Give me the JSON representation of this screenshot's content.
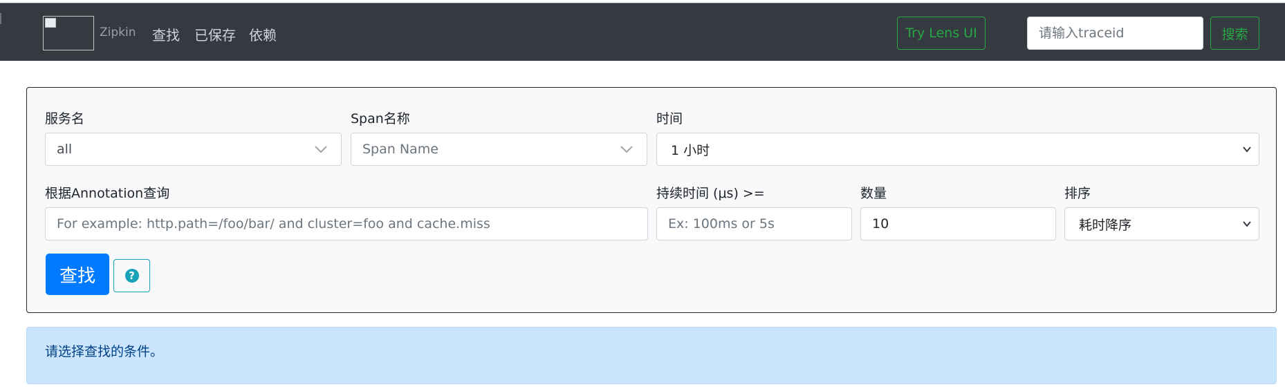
{
  "navbar": {
    "brand": "Zipkin",
    "links": [
      "查找",
      "已保存",
      "依赖"
    ],
    "lens_button": "Try Lens UI",
    "traceid_placeholder": "请输入traceid",
    "search_button": "搜索"
  },
  "form": {
    "service_label": "服务名",
    "service_value": "all",
    "span_label": "Span名称",
    "span_placeholder": "Span Name",
    "time_label": "时间",
    "time_value": "1 小时",
    "annotation_label": "根据Annotation查询",
    "annotation_placeholder": "For example: http.path=/foo/bar/ and cluster=foo and cache.miss",
    "duration_label": "持续时间 (μs) >=",
    "duration_placeholder": "Ex: 100ms or 5s",
    "limit_label": "数量",
    "limit_value": "10",
    "sort_label": "排序",
    "sort_value": "耗时降序",
    "find_button": "查找",
    "help_icon": "?"
  },
  "alert": {
    "message": "请选择查找的条件。"
  },
  "colors": {
    "navbar_bg": "#343a40",
    "success": "#28a745",
    "primary": "#007bff",
    "info": "#17a2b8",
    "alert_bg": "#cce5ff"
  }
}
